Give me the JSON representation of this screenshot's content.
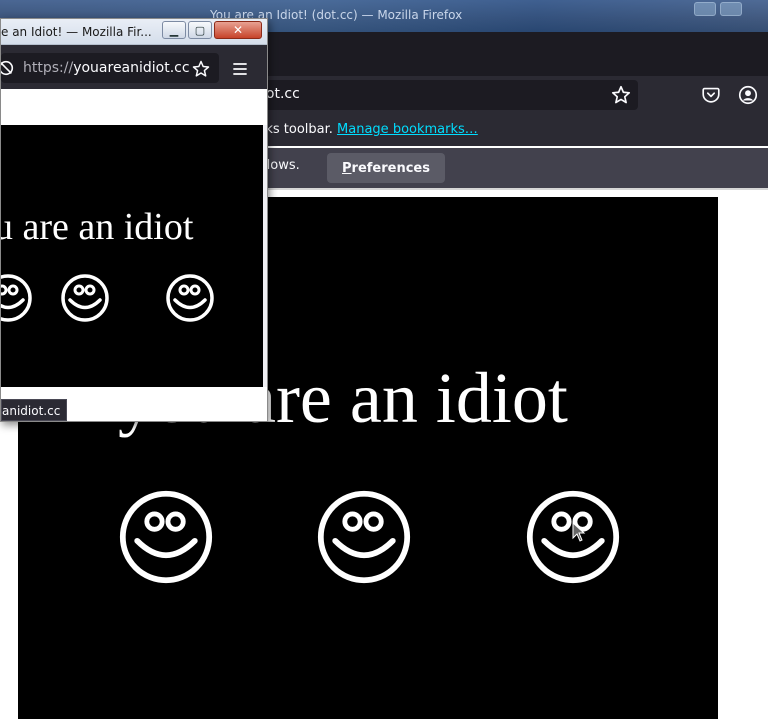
{
  "back_window": {
    "title": "You are an Idiot! (dot.cc) — Mozilla Firefox",
    "url": "iot.cc",
    "bookmarks_text": "rks toolbar.",
    "bookmarks_link": "Manage bookmarks…",
    "notification_text": "dows.",
    "preferences_button_underlined": "P",
    "preferences_button_rest": "references",
    "page_title": "you are an idiot",
    "icons": [
      "star-icon",
      "pocket-icon",
      "account-icon",
      "smiley-icon"
    ]
  },
  "front_window": {
    "title": "e an Idiot! — Mozilla Fir...",
    "url_scheme": "https://",
    "url_host": "youareanidiot.cc",
    "page_title": "ou are an idiot",
    "status_link": "anidiot.cc",
    "buttons": {
      "minimize": "▁",
      "maximize": "▢",
      "close": "✕"
    },
    "icons": [
      "shield-icon",
      "star-icon",
      "hamburger-menu-icon",
      "smiley-icon"
    ]
  },
  "colors": {
    "firefox_dark": "#2b2a33",
    "firefox_darker": "#1c1b22",
    "link": "#00ddff",
    "content_bg": "#000000",
    "content_fg": "#ffffff"
  }
}
